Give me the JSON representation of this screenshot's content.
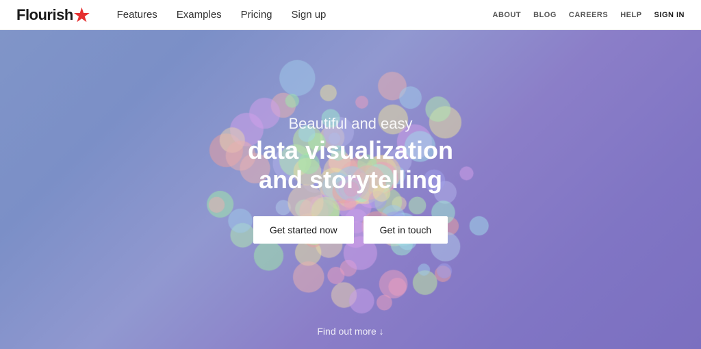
{
  "navbar": {
    "logo": "Flourish",
    "logo_dot": "•",
    "nav_primary": [
      {
        "label": "Features",
        "href": "#"
      },
      {
        "label": "Examples",
        "href": "#"
      },
      {
        "label": "Pricing",
        "href": "#"
      },
      {
        "label": "Sign up",
        "href": "#"
      }
    ],
    "nav_secondary": [
      {
        "label": "About",
        "href": "#"
      },
      {
        "label": "Blog",
        "href": "#"
      },
      {
        "label": "Careers",
        "href": "#"
      },
      {
        "label": "Help",
        "href": "#"
      },
      {
        "label": "Sign in",
        "href": "#",
        "class": "sign-in"
      }
    ]
  },
  "hero": {
    "subtitle": "Beautiful and easy",
    "title_line1": "data visualization",
    "title_line2": "and storytelling",
    "btn_primary": "Get started now",
    "btn_secondary": "Get in touch",
    "find_out_more": "Find out more ↓"
  },
  "bubbles": {
    "colors": [
      "#e8a0a0",
      "#a0c8e8",
      "#a0e8a8",
      "#c8a0e8",
      "#e8c8a0",
      "#a0a0e8",
      "#e8e0a0",
      "#a0e8d0",
      "#e8b0b0",
      "#b0c8e8",
      "#b0e8b0",
      "#d0a0e8",
      "#e8d0b0",
      "#b0b0e8",
      "#a0d8e8",
      "#e8a0c0",
      "#c0e8a0"
    ]
  }
}
